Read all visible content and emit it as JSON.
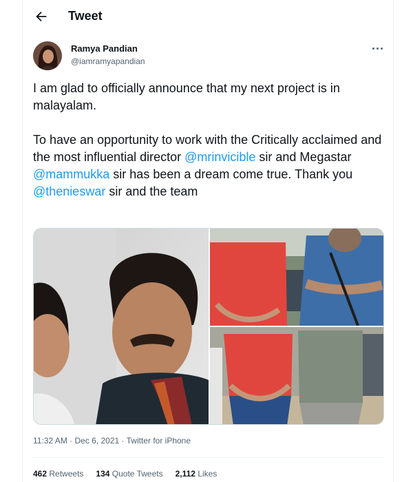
{
  "header": {
    "title": "Tweet",
    "back_icon": "arrow-left-icon"
  },
  "author": {
    "name": "Ramya Pandian",
    "handle": "@iamramyapandian"
  },
  "tweet": {
    "line1": "I am glad to officially announce that my next project is in malayalam.",
    "p2_a": "To have an opportunity to work with the Critically acclaimed and the most influential director ",
    "mention1": "@mrinvicible",
    "p2_b": " sir and Megastar ",
    "mention2": "@mammukka",
    "p2_c": " sir has been a dream come true. Thank you ",
    "mention3": "@thenieswar",
    "p2_d": " sir and the team"
  },
  "meta": {
    "time": "11:32 AM · Dec 6, 2021 · ",
    "source": "Twitter for iPhone"
  },
  "stats": {
    "retweets_count": "462",
    "retweets_label": "Retweets",
    "quotes_count": "134",
    "quotes_label": "Quote Tweets",
    "likes_count": "2,112",
    "likes_label": "Likes"
  },
  "colors": {
    "accent": "#1d9bf0",
    "text": "#0f1419",
    "muted": "#536471",
    "border": "#eff3f4"
  }
}
